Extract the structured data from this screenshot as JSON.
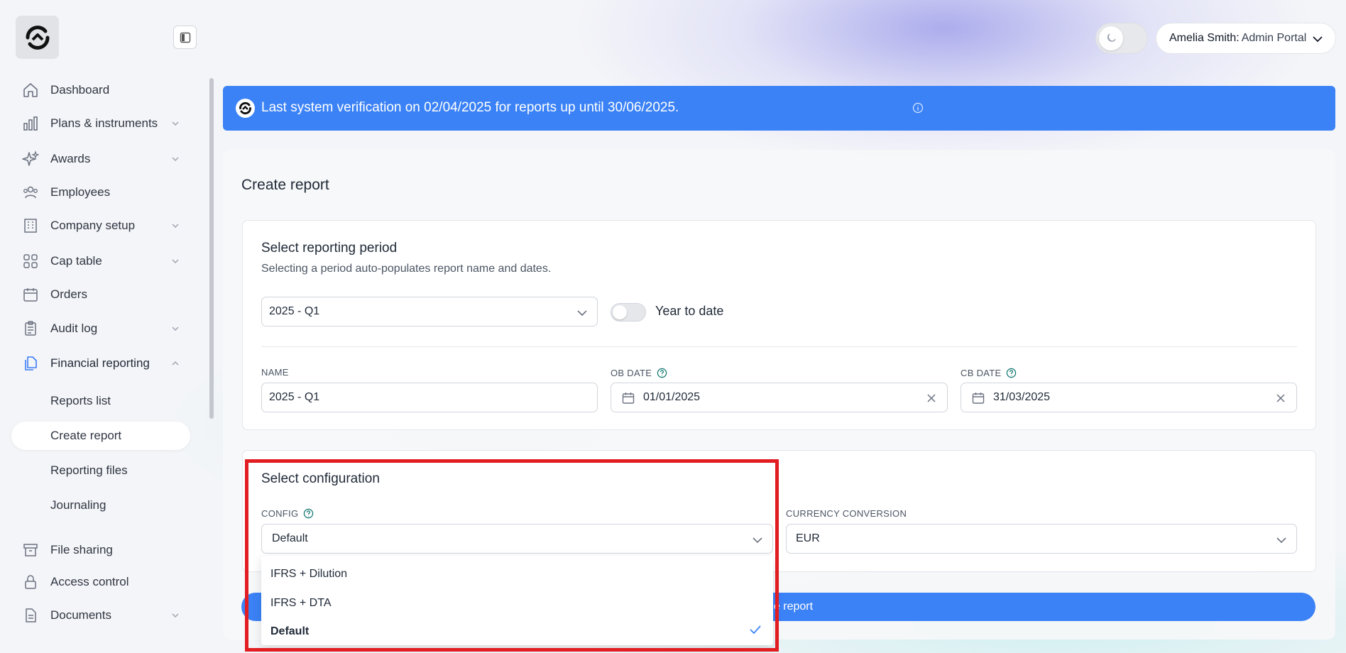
{
  "sidebar": {
    "items": [
      {
        "label": "Dashboard",
        "icon": "home-icon",
        "has_chevron": false
      },
      {
        "label": "Plans & instruments",
        "icon": "bar-chart-icon",
        "has_chevron": true
      },
      {
        "label": "Awards",
        "icon": "sparkles-icon",
        "has_chevron": true
      },
      {
        "label": "Employees",
        "icon": "users-icon",
        "has_chevron": false
      },
      {
        "label": "Company setup",
        "icon": "building-icon",
        "has_chevron": true
      },
      {
        "label": "Cap table",
        "icon": "grid-icon",
        "has_chevron": true
      },
      {
        "label": "Orders",
        "icon": "calendar-icon",
        "has_chevron": false
      },
      {
        "label": "Audit log",
        "icon": "clipboard-icon",
        "has_chevron": true
      },
      {
        "label": "Financial reporting",
        "icon": "files-icon",
        "has_chevron": true,
        "expanded": true
      },
      {
        "label": "File sharing",
        "icon": "archive-icon",
        "has_chevron": false
      },
      {
        "label": "Access control",
        "icon": "lock-icon",
        "has_chevron": false
      },
      {
        "label": "Documents",
        "icon": "document-icon",
        "has_chevron": true
      }
    ],
    "sub_items": [
      {
        "label": "Reports list"
      },
      {
        "label": "Create report",
        "selected": true
      },
      {
        "label": "Reporting files"
      },
      {
        "label": "Journaling"
      }
    ]
  },
  "header": {
    "user_name": "Amelia Smith:",
    "portal": "Admin Portal"
  },
  "banner": {
    "text": "Last system verification on 02/04/2025 for reports up until 30/06/2025."
  },
  "page": {
    "title": "Create report"
  },
  "period_panel": {
    "title": "Select reporting period",
    "subtitle": "Selecting a period auto-populates report name and dates.",
    "period_value": "2025 - Q1",
    "ytd_label": "Year to date",
    "ytd_on": false,
    "name_label": "NAME",
    "name_value": "2025 - Q1",
    "ob_label": "OB DATE",
    "ob_value": "01/01/2025",
    "cb_label": "CB DATE",
    "cb_value": "31/03/2025"
  },
  "config_panel": {
    "title": "Select configuration",
    "config_label": "CONFIG",
    "config_value": "Default",
    "currency_label": "CURRENCY CONVERSION",
    "currency_value": "EUR",
    "options": [
      {
        "label": "IFRS + Dilution",
        "selected": false
      },
      {
        "label": "IFRS + DTA",
        "selected": false
      },
      {
        "label": "Default",
        "selected": true
      }
    ]
  },
  "create_button": {
    "visible_label": "e report"
  },
  "colors": {
    "accent": "#3b82f6",
    "highlight": "#e11d22"
  }
}
